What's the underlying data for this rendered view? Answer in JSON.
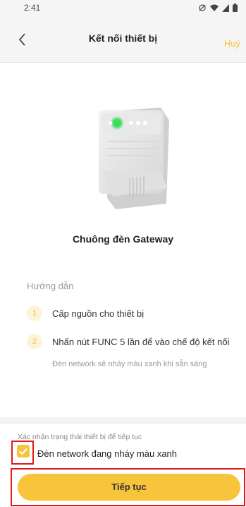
{
  "status_bar": {
    "time": "2:41"
  },
  "header": {
    "title": "Kết nối thiết bị",
    "cancel_label": "Huỷ"
  },
  "device": {
    "name": "Chuông đèn Gateway"
  },
  "guide": {
    "label": "Hướng dẫn",
    "steps": [
      {
        "number": "1",
        "text": "Cấp nguồn cho thiết bị"
      },
      {
        "number": "2",
        "text": "Nhấn nút FUNC 5 lần để vào chế độ kết nối"
      }
    ],
    "note": "Đèn network sẽ nháy màu xanh khi sẵn sàng"
  },
  "confirm": {
    "label": "Xác nhận trạng thái thiết bị để tiếp tục",
    "checkbox_label": "Đèn network đang nháy màu xanh",
    "checked": true
  },
  "action": {
    "continue_label": "Tiếp tục"
  },
  "colors": {
    "accent": "#f7c43c",
    "highlight_frame": "#e01a1a",
    "led": "#3ddc5a"
  }
}
